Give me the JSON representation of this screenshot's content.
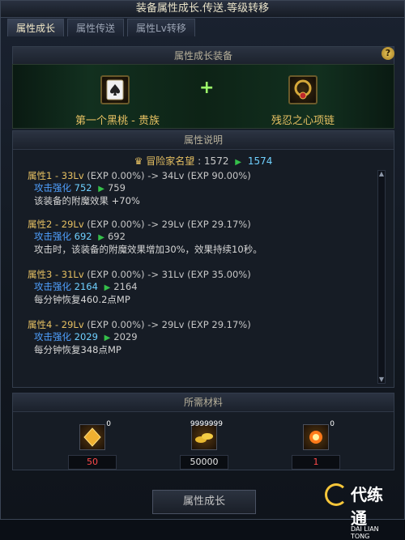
{
  "window": {
    "title": "装备属性成长.传送.等级转移"
  },
  "tabs": [
    {
      "label": "属性成长"
    },
    {
      "label": "属性传送"
    },
    {
      "label": "属性Lv转移"
    }
  ],
  "equip_section": {
    "header": "属性成长装备",
    "left_item": "第一个黑桃 - 贵族",
    "right_item": "残忍之心项链",
    "plus": "+"
  },
  "description": {
    "header": "属性说明",
    "fame_label": "冒险家名望",
    "fame_from": ": 1572",
    "fame_to": "1574",
    "arrow": "▶",
    "props": [
      {
        "head": "属性1 - 33Lv",
        "exp_from": "(EXP 0.00%)",
        "arrow_text": "->",
        "target": "34Lv",
        "exp_to": "(EXP 90.00%)",
        "sub_name": "攻击强化",
        "sub_from": "752",
        "sub_to": "759",
        "note": "该装备的附魔效果 +70%"
      },
      {
        "head": "属性2 - 29Lv",
        "exp_from": "(EXP 0.00%)",
        "arrow_text": "->",
        "target": "29Lv",
        "exp_to": "(EXP 29.17%)",
        "sub_name": "攻击强化",
        "sub_from": "692",
        "sub_to": "692",
        "note": "攻击时，该装备的附魔效果增加30%，效果持续10秒。"
      },
      {
        "head": "属性3 - 31Lv",
        "exp_from": "(EXP 0.00%)",
        "arrow_text": "->",
        "target": "31Lv",
        "exp_to": "(EXP 35.00%)",
        "sub_name": "攻击强化",
        "sub_from": "2164",
        "sub_to": "2164",
        "note": "每分钟恢复460.2点MP"
      },
      {
        "head": "属性4 - 29Lv",
        "exp_from": "(EXP 0.00%)",
        "arrow_text": "->",
        "target": "29Lv",
        "exp_to": "(EXP 29.17%)",
        "sub_name": "攻击强化",
        "sub_from": "2029",
        "sub_to": "2029",
        "note": "每分钟恢复348点MP"
      }
    ]
  },
  "materials": {
    "header": "所需材料",
    "items": [
      {
        "icon": "gold-crystal-icon",
        "badge": "0",
        "count": "50"
      },
      {
        "icon": "gold-coins-icon",
        "badge": "9999999",
        "count": "50000"
      },
      {
        "icon": "fire-orb-icon",
        "badge": "0",
        "count": "1"
      }
    ]
  },
  "bottom_button": "属性成长",
  "help": "?",
  "watermark": {
    "text": "代练通",
    "sub": "DAI LIAN TONG"
  }
}
